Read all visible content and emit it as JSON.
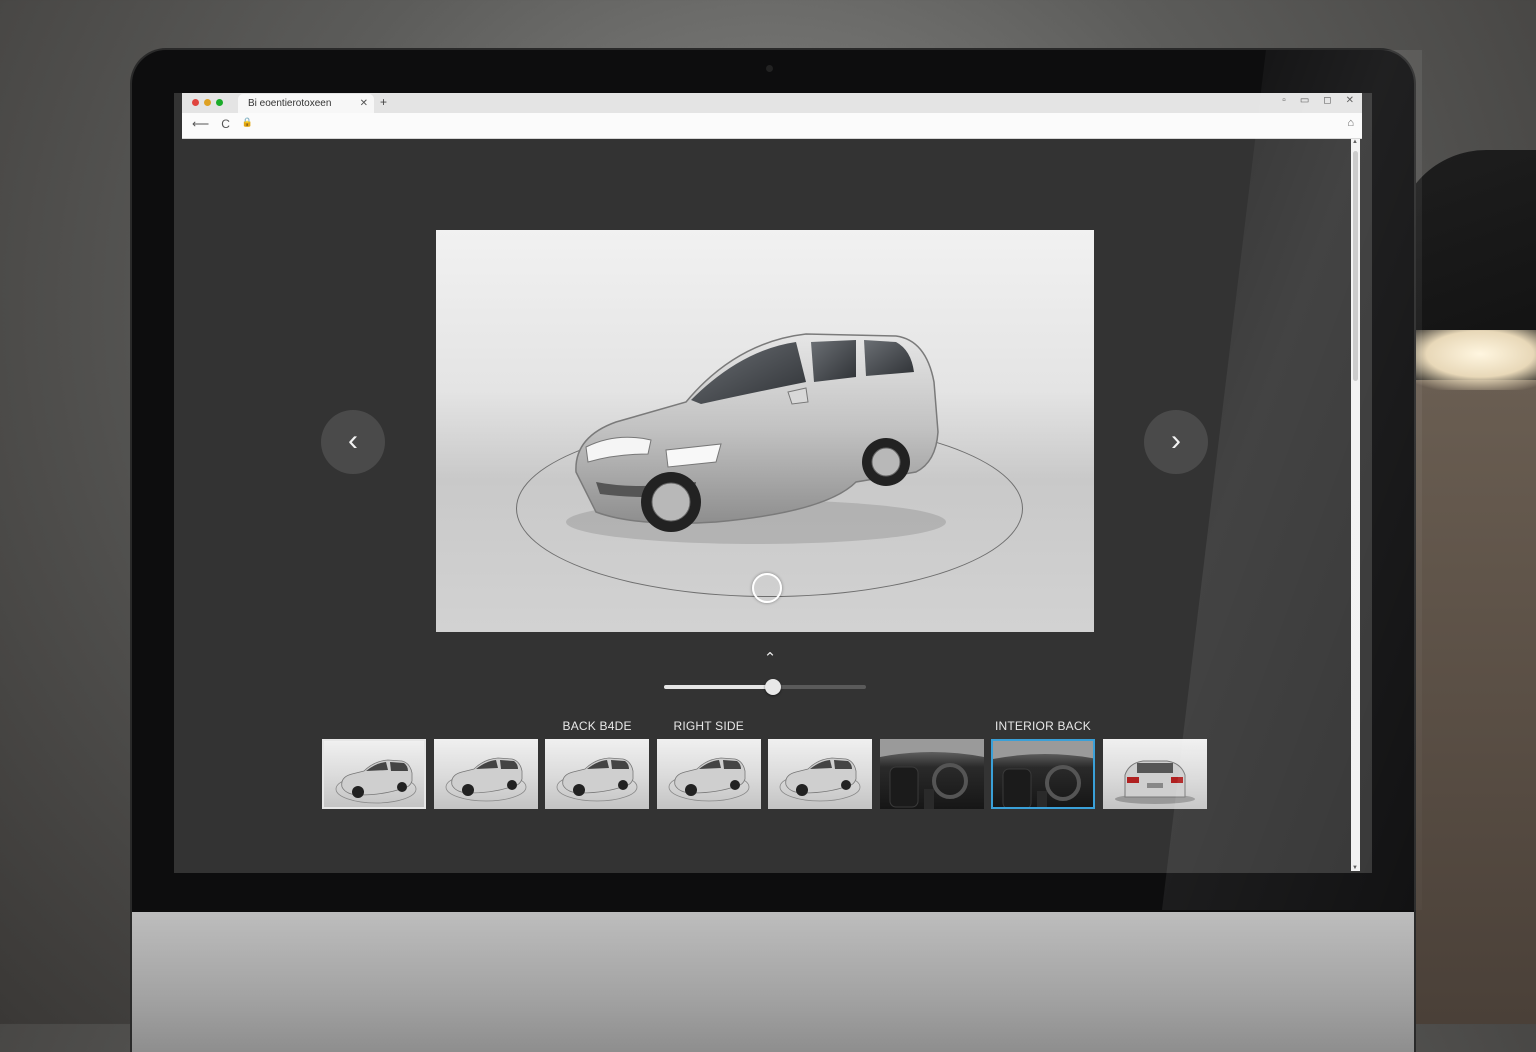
{
  "browser": {
    "tab_title": "Bi eoentierotoxeen",
    "tab_close": "✕",
    "new_tab": "+",
    "window_controls": [
      "▫",
      "▭",
      "◻",
      "✕"
    ],
    "nav": {
      "back": "⟵",
      "reload": "C",
      "lock": "🔒"
    },
    "nav_right": "⌂"
  },
  "viewer": {
    "prev_icon": "chevron-left-icon",
    "next_icon": "chevron-right-icon",
    "prev_glyph": "‹",
    "next_glyph": "›",
    "collapse_glyph": "⌃",
    "zoom_slider": {
      "value": 0.54
    }
  },
  "thumbnails": {
    "labels": [
      {
        "text": "BACK B4DE",
        "index": 2
      },
      {
        "text": "RIGHT SIDE",
        "index": 3
      },
      {
        "text": "INTERIOR BACK",
        "index": 6
      }
    ],
    "items": [
      {
        "kind": "exterior",
        "selected": true
      },
      {
        "kind": "exterior"
      },
      {
        "kind": "exterior"
      },
      {
        "kind": "exterior"
      },
      {
        "kind": "exterior"
      },
      {
        "kind": "interior"
      },
      {
        "kind": "interior",
        "active": true
      },
      {
        "kind": "rear"
      }
    ]
  },
  "colors": {
    "accent": "#3aa0d8",
    "background": "#333333"
  }
}
